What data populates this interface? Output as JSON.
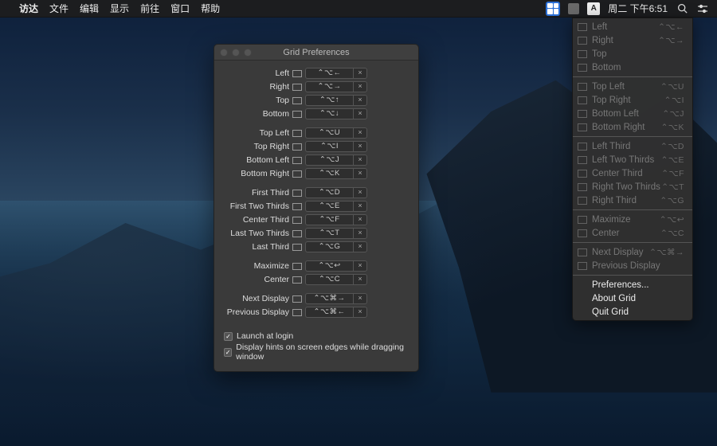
{
  "menubar": {
    "app_menu": [
      "访达",
      "文件",
      "编辑",
      "显示",
      "前往",
      "窗口",
      "帮助"
    ],
    "clock": "周二 下午6:51",
    "a_indicator": "A"
  },
  "dropdown": {
    "groups": [
      [
        {
          "label": "Left",
          "shortcut": "⌃⌥←",
          "enabled": false
        },
        {
          "label": "Right",
          "shortcut": "⌃⌥→",
          "enabled": false
        },
        {
          "label": "Top",
          "shortcut": "",
          "enabled": false
        },
        {
          "label": "Bottom",
          "shortcut": "",
          "enabled": false
        }
      ],
      [
        {
          "label": "Top Left",
          "shortcut": "⌃⌥U",
          "enabled": false
        },
        {
          "label": "Top Right",
          "shortcut": "⌃⌥I",
          "enabled": false
        },
        {
          "label": "Bottom Left",
          "shortcut": "⌃⌥J",
          "enabled": false
        },
        {
          "label": "Bottom Right",
          "shortcut": "⌃⌥K",
          "enabled": false
        }
      ],
      [
        {
          "label": "Left Third",
          "shortcut": "⌃⌥D",
          "enabled": false
        },
        {
          "label": "Left Two Thirds",
          "shortcut": "⌃⌥E",
          "enabled": false
        },
        {
          "label": "Center Third",
          "shortcut": "⌃⌥F",
          "enabled": false
        },
        {
          "label": "Right Two Thirds",
          "shortcut": "⌃⌥T",
          "enabled": false
        },
        {
          "label": "Right Third",
          "shortcut": "⌃⌥G",
          "enabled": false
        }
      ],
      [
        {
          "label": "Maximize",
          "shortcut": "⌃⌥↩",
          "enabled": false
        },
        {
          "label": "Center",
          "shortcut": "⌃⌥C",
          "enabled": false
        }
      ],
      [
        {
          "label": "Next Display",
          "shortcut": "⌃⌥⌘→",
          "enabled": false
        },
        {
          "label": "Previous Display",
          "shortcut": "",
          "enabled": false
        }
      ],
      [
        {
          "label": "Preferences...",
          "shortcut": "",
          "enabled": true
        },
        {
          "label": "About Grid",
          "shortcut": "",
          "enabled": true
        },
        {
          "label": "Quit Grid",
          "shortcut": "",
          "enabled": true
        }
      ]
    ]
  },
  "prefwin": {
    "title": "Grid Preferences",
    "groups": [
      [
        {
          "label": "Left",
          "shortcut": "⌃⌥←"
        },
        {
          "label": "Right",
          "shortcut": "⌃⌥→"
        },
        {
          "label": "Top",
          "shortcut": "⌃⌥↑"
        },
        {
          "label": "Bottom",
          "shortcut": "⌃⌥↓"
        }
      ],
      [
        {
          "label": "Top Left",
          "shortcut": "⌃⌥U"
        },
        {
          "label": "Top Right",
          "shortcut": "⌃⌥I"
        },
        {
          "label": "Bottom Left",
          "shortcut": "⌃⌥J"
        },
        {
          "label": "Bottom Right",
          "shortcut": "⌃⌥K"
        }
      ],
      [
        {
          "label": "First Third",
          "shortcut": "⌃⌥D"
        },
        {
          "label": "First Two Thirds",
          "shortcut": "⌃⌥E"
        },
        {
          "label": "Center Third",
          "shortcut": "⌃⌥F"
        },
        {
          "label": "Last Two Thirds",
          "shortcut": "⌃⌥T"
        },
        {
          "label": "Last Third",
          "shortcut": "⌃⌥G"
        }
      ],
      [
        {
          "label": "Maximize",
          "shortcut": "⌃⌥↩"
        },
        {
          "label": "Center",
          "shortcut": "⌃⌥C"
        }
      ],
      [
        {
          "label": "Next Display",
          "shortcut": "⌃⌥⌘→"
        },
        {
          "label": "Previous Display",
          "shortcut": "⌃⌥⌘←"
        }
      ]
    ],
    "clear_glyph": "×",
    "checkboxes": [
      {
        "label": "Launch at login",
        "checked": true
      },
      {
        "label": "Display hints on screen edges while dragging window",
        "checked": true
      }
    ]
  }
}
